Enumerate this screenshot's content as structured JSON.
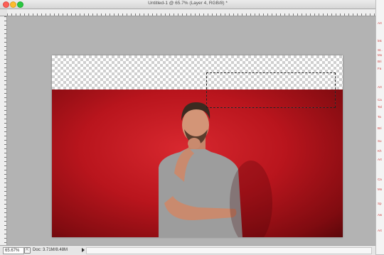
{
  "window": {
    "title": "Untitled-1 @ 65.7% (Layer 4, RGB/8) *"
  },
  "status_bar": {
    "zoom": "65.67%",
    "doc_info": "Doc: 3.71M/8.48M"
  },
  "right_panel": {
    "items": [
      "Art",
      "lnk",
      "St..",
      "Mo",
      "Bri",
      "Fa",
      "Art",
      "Ca",
      "Tal",
      "Ta",
      "Bri",
      "Su",
      "Kh",
      "Art",
      "Ca",
      "Mo",
      "Sp",
      "Aw",
      "Art"
    ]
  },
  "colors": {
    "background_red": "#c41a22",
    "selection_marquee": "#ffffff"
  }
}
